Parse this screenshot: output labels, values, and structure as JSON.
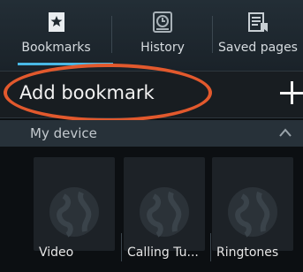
{
  "tabs": [
    {
      "label": "Bookmarks",
      "icon": "star-bookmark-icon",
      "active": true
    },
    {
      "label": "History",
      "icon": "clock-history-icon",
      "active": false
    },
    {
      "label": "Saved pages",
      "icon": "saved-pages-icon",
      "active": false
    }
  ],
  "add_bookmark": {
    "label": "Add bookmark",
    "icon": "plus-icon"
  },
  "section": {
    "label": "My device",
    "icon": "chevron-up-icon"
  },
  "thumbnails": [
    {
      "label": "Video",
      "icon": "globe-icon"
    },
    {
      "label": "Calling Tu...",
      "icon": "globe-icon"
    },
    {
      "label": "Ringtones",
      "icon": "globe-icon"
    }
  ],
  "colors": {
    "accent": "#49b8e6",
    "annotation": "#e2592d"
  }
}
